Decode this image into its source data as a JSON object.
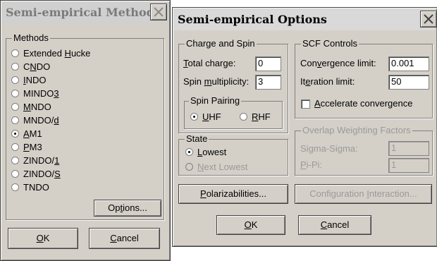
{
  "method_dialog": {
    "title": "Semi-empirical Method",
    "methods_group_label": "Methods",
    "methods": [
      {
        "pre": "Extended ",
        "key": "H",
        "post": "ucke",
        "selected": false
      },
      {
        "pre": "C",
        "key": "N",
        "post": "DO",
        "selected": false
      },
      {
        "pre": "",
        "key": "I",
        "post": "NDO",
        "selected": false
      },
      {
        "pre": "MINDO",
        "key": "3",
        "post": "",
        "selected": false
      },
      {
        "pre": "",
        "key": "M",
        "post": "NDO",
        "selected": false
      },
      {
        "pre": "MNDO/",
        "key": "d",
        "post": "",
        "selected": false
      },
      {
        "pre": "",
        "key": "A",
        "post": "M1",
        "selected": true
      },
      {
        "pre": "",
        "key": "P",
        "post": "M3",
        "selected": false
      },
      {
        "pre": "ZINDO/",
        "key": "1",
        "post": "",
        "selected": false
      },
      {
        "pre": "ZINDO/",
        "key": "S",
        "post": "",
        "selected": false
      },
      {
        "pre": "TNDO",
        "key": "",
        "post": "",
        "selected": false
      }
    ],
    "options_button": {
      "pre": "Op",
      "key": "t",
      "post": "ions..."
    },
    "ok_button": {
      "pre": "",
      "key": "O",
      "post": "K"
    },
    "cancel_button": {
      "pre": "",
      "key": "C",
      "post": "ancel"
    }
  },
  "options_dialog": {
    "title": "Semi-empirical Options",
    "charge_spin": {
      "group_label": "Charge and Spin",
      "total_charge": {
        "pre": "",
        "key": "T",
        "post": "otal charge:",
        "value": "0"
      },
      "spin_multiplicity": {
        "pre": "Spin ",
        "key": "m",
        "post": "ultiplicity:",
        "value": "3"
      },
      "spin_pairing": {
        "group_label": "Spin Pairing",
        "options": [
          {
            "pre": "",
            "key": "U",
            "post": "HF",
            "selected": true
          },
          {
            "pre": "",
            "key": "R",
            "post": "HF",
            "selected": false
          }
        ]
      }
    },
    "scf": {
      "group_label": "SCF Controls",
      "convergence_limit": {
        "pre": "Con",
        "key": "v",
        "post": "ergence limit:",
        "value": "0.001"
      },
      "iteration_limit": {
        "pre": "It",
        "key": "e",
        "post": "ration limit:",
        "value": "50"
      },
      "accelerate": {
        "pre": "",
        "key": "A",
        "post": "ccelerate convergence",
        "checked": false
      }
    },
    "state": {
      "group_label": "State",
      "options": [
        {
          "pre": "",
          "key": "L",
          "post": "owest",
          "selected": true,
          "enabled": true
        },
        {
          "pre": "",
          "key": "N",
          "post": "ext Lowest",
          "selected": false,
          "enabled": false
        }
      ]
    },
    "overlap": {
      "group_label": "Overlap Weighting Factors",
      "sigma_sigma": {
        "pre": "Si",
        "key": "g",
        "post": "ma-Sigma:",
        "value": "1"
      },
      "pi_pi": {
        "pre": "",
        "key": "P",
        "post": "i-Pi:",
        "value": "1"
      }
    },
    "polarizabilities_button": {
      "pre": "",
      "key": "P",
      "post": "olarizabilities..."
    },
    "config_interaction_button": {
      "pre": "Configuration ",
      "key": "I",
      "post": "nteraction..."
    },
    "ok_button": {
      "pre": "",
      "key": "O",
      "post": "K"
    },
    "cancel_button": {
      "pre": "",
      "key": "C",
      "post": "ancel"
    }
  }
}
